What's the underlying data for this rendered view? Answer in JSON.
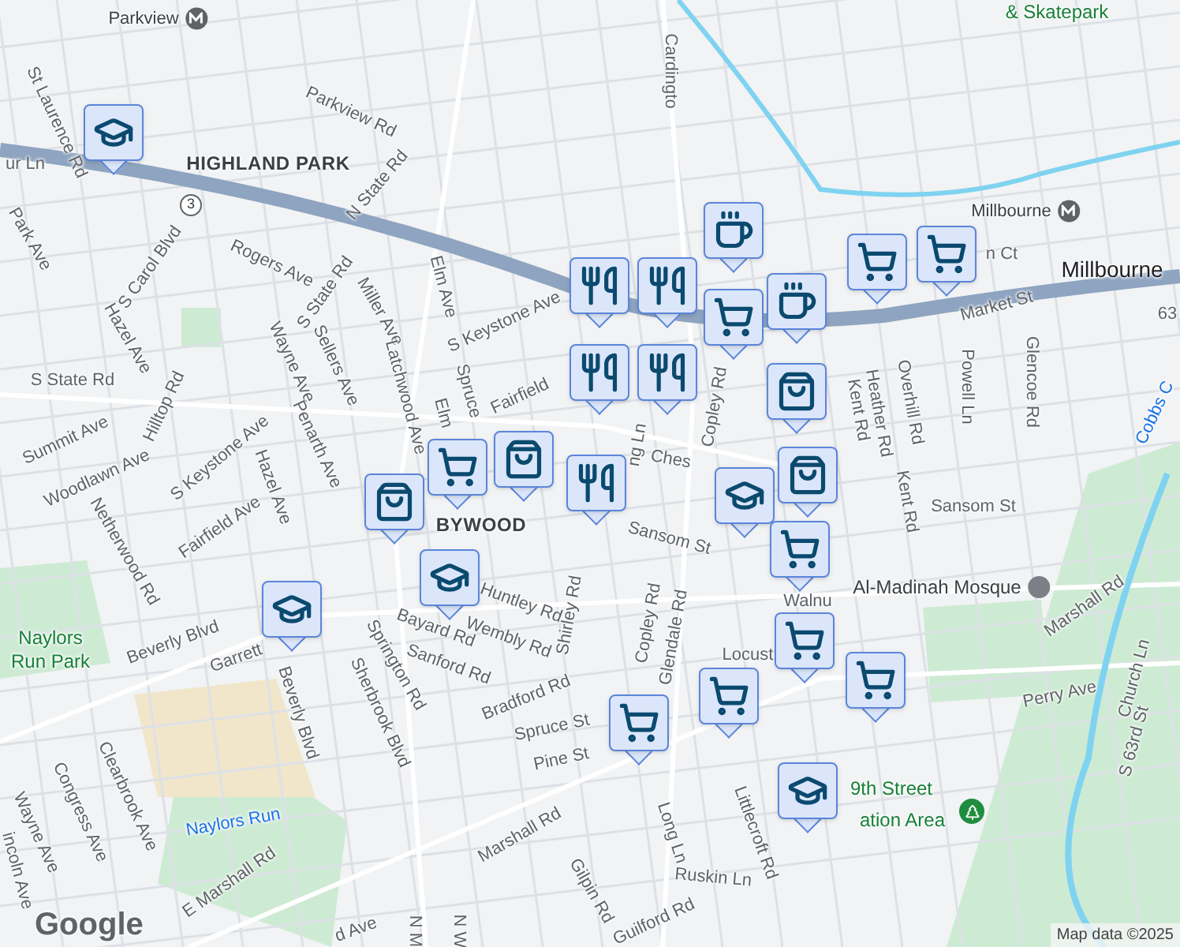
{
  "labels": [
    {
      "text": "Parkview",
      "kind": "station"
    },
    {
      "text": "Cardingto",
      "kind": "street"
    },
    {
      "text": "& Skatepark",
      "kind": "park"
    },
    {
      "text": "St Laurence Rd",
      "kind": "street"
    },
    {
      "text": "Parkview Rd",
      "kind": "street"
    },
    {
      "text": "HIGHLAND PARK",
      "kind": "area"
    },
    {
      "text": "N State Rd",
      "kind": "street"
    },
    {
      "text": "Millbourne",
      "kind": "station"
    },
    {
      "text": "Millbourne",
      "kind": "city"
    },
    {
      "text": "63",
      "kind": "street"
    },
    {
      "text": "Rogers Ave",
      "kind": "street"
    },
    {
      "text": "S State Rd",
      "kind": "street"
    },
    {
      "text": "S Carol Blvd",
      "kind": "street"
    },
    {
      "text": "Park Ave",
      "kind": "street"
    },
    {
      "text": "ur Ln",
      "kind": "street"
    },
    {
      "text": "Hazel Ave",
      "kind": "street"
    },
    {
      "text": "Miller Ave",
      "kind": "street"
    },
    {
      "text": "Elm Ave",
      "kind": "street"
    },
    {
      "text": "S Keystone Ave",
      "kind": "street"
    },
    {
      "text": "Sellers Ave",
      "kind": "street"
    },
    {
      "text": "Wayne Ave",
      "kind": "street"
    },
    {
      "text": "Latchwood Ave",
      "kind": "street"
    },
    {
      "text": "Spruce",
      "kind": "street"
    },
    {
      "text": "Fairfield",
      "kind": "street"
    },
    {
      "text": "S State Rd",
      "kind": "street"
    },
    {
      "text": "Hilltop Rd",
      "kind": "street"
    },
    {
      "text": "Summit Ave",
      "kind": "street"
    },
    {
      "text": "Woodlawn Ave",
      "kind": "street"
    },
    {
      "text": "S Keystone Ave",
      "kind": "street"
    },
    {
      "text": "Penarth Ave",
      "kind": "street"
    },
    {
      "text": "Elm",
      "kind": "street"
    },
    {
      "text": "Hazel Ave",
      "kind": "street"
    },
    {
      "text": "Netherwood Rd",
      "kind": "street"
    },
    {
      "text": "Fairfield Ave",
      "kind": "street"
    },
    {
      "text": "Market St",
      "kind": "street"
    },
    {
      "text": "n Ct",
      "kind": "street"
    },
    {
      "text": "Overhill Rd",
      "kind": "street"
    },
    {
      "text": "Powell Ln",
      "kind": "street"
    },
    {
      "text": "Glencoe Rd",
      "kind": "street"
    },
    {
      "text": "Cobbs C",
      "kind": "water"
    },
    {
      "text": "Copley Rd",
      "kind": "street"
    },
    {
      "text": "Kent Rd",
      "kind": "street"
    },
    {
      "text": "Heather Rd",
      "kind": "street"
    },
    {
      "text": "Kent Rd",
      "kind": "street"
    },
    {
      "text": "Ches",
      "kind": "street"
    },
    {
      "text": "ng Ln",
      "kind": "street"
    },
    {
      "text": "Sansom St",
      "kind": "street"
    },
    {
      "text": "Sansom St",
      "kind": "street"
    },
    {
      "text": "BYWOOD",
      "kind": "area"
    },
    {
      "text": "Huntley Rd",
      "kind": "street"
    },
    {
      "text": "Bayard Rd",
      "kind": "street"
    },
    {
      "text": "Wembly Rd",
      "kind": "street"
    },
    {
      "text": "Shirley Rd",
      "kind": "street"
    },
    {
      "text": "Copley Rd",
      "kind": "street"
    },
    {
      "text": "Glendale Rd",
      "kind": "street"
    },
    {
      "text": "Walnu",
      "kind": "street"
    },
    {
      "text": "Al-Madinah Mosque",
      "kind": "place"
    },
    {
      "text": "Marshall Rd",
      "kind": "street"
    },
    {
      "text": "Church Ln",
      "kind": "street"
    },
    {
      "text": "Locust",
      "kind": "street"
    },
    {
      "text": "Perry Ave",
      "kind": "street"
    },
    {
      "text": "S 63rd St",
      "kind": "street"
    },
    {
      "text": "Naylors\nRun Park",
      "kind": "park"
    },
    {
      "text": "Beverly Blvd",
      "kind": "street"
    },
    {
      "text": "Garrett",
      "kind": "street"
    },
    {
      "text": "Springton Rd",
      "kind": "street"
    },
    {
      "text": "Sanford Rd",
      "kind": "street"
    },
    {
      "text": "Bradford Rd",
      "kind": "street"
    },
    {
      "text": "Spruce St",
      "kind": "street"
    },
    {
      "text": "Pine St",
      "kind": "street"
    },
    {
      "text": "Sherbrook Blvd",
      "kind": "street"
    },
    {
      "text": "Beverly Blvd",
      "kind": "street"
    },
    {
      "text": "Littlecroft Rd",
      "kind": "street"
    },
    {
      "text": "9th Street",
      "kind": "park"
    },
    {
      "text": "ation Area",
      "kind": "park"
    },
    {
      "text": "Marshall Rd",
      "kind": "street"
    },
    {
      "text": "Long Ln",
      "kind": "street"
    },
    {
      "text": "Gilpin Rd",
      "kind": "street"
    },
    {
      "text": "Ruskin Ln",
      "kind": "street"
    },
    {
      "text": "Guilford Rd",
      "kind": "street"
    },
    {
      "text": "N M",
      "kind": "street"
    },
    {
      "text": "N W",
      "kind": "street"
    },
    {
      "text": "E Marshall Rd",
      "kind": "street"
    },
    {
      "text": "d Ave",
      "kind": "street"
    },
    {
      "text": "Clearbrook Ave",
      "kind": "street"
    },
    {
      "text": "Congress Ave",
      "kind": "street"
    },
    {
      "text": "Wayne Ave",
      "kind": "street"
    },
    {
      "text": "incoln Ave",
      "kind": "street"
    },
    {
      "text": "Naylors Run",
      "kind": "water"
    }
  ],
  "pins": [
    {
      "kind": "school"
    },
    {
      "kind": "school"
    },
    {
      "kind": "school"
    },
    {
      "kind": "school"
    },
    {
      "kind": "school"
    },
    {
      "kind": "cafe"
    },
    {
      "kind": "cafe"
    },
    {
      "kind": "restaurant"
    },
    {
      "kind": "restaurant"
    },
    {
      "kind": "restaurant"
    },
    {
      "kind": "restaurant"
    },
    {
      "kind": "restaurant"
    },
    {
      "kind": "shopping"
    },
    {
      "kind": "shopping"
    },
    {
      "kind": "shopping"
    },
    {
      "kind": "shopping"
    },
    {
      "kind": "grocery"
    },
    {
      "kind": "grocery"
    },
    {
      "kind": "grocery"
    },
    {
      "kind": "grocery"
    },
    {
      "kind": "grocery"
    },
    {
      "kind": "grocery"
    },
    {
      "kind": "grocery"
    },
    {
      "kind": "grocery"
    },
    {
      "kind": "grocery"
    }
  ],
  "route_shield": "3",
  "logo": "Google",
  "attribution": "Map data ©2025"
}
